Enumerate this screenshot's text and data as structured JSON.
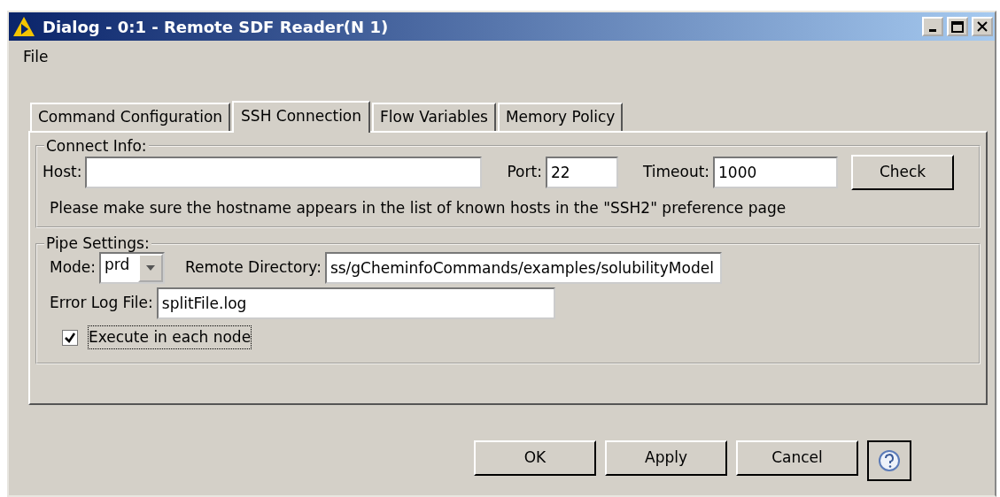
{
  "window": {
    "title": "Dialog - 0:1 - Remote SDF Reader(N 1)"
  },
  "menu": [
    "File"
  ],
  "tabs": [
    {
      "label": "Command Configuration",
      "selected": false
    },
    {
      "label": "SSH Connection",
      "selected": true
    },
    {
      "label": "Flow Variables",
      "selected": false
    },
    {
      "label": "Memory Policy",
      "selected": false
    }
  ],
  "connect_info": {
    "title": "Connect Info:",
    "host": {
      "label": "Host:"
    },
    "port": {
      "label": "Port:",
      "value": "22"
    },
    "timeout": {
      "label": "Timeout:",
      "value": "1000"
    },
    "check_button": "Check",
    "note": "Please make sure the hostname appears in the list of known hosts in the \"SSH2\" preference page"
  },
  "pipe_settings": {
    "title": "Pipe Settings:",
    "mode": {
      "label": "Mode:",
      "value": "prd"
    },
    "remote_directory": {
      "label": "Remote Directory:",
      "value": "ss/gCheminfoCommands/examples/solubilityModel"
    },
    "error_log_file": {
      "label": "Error Log File:",
      "value": "splitFile.log"
    },
    "execute_in_each_node": {
      "label": "Execute in each node",
      "checked": true
    }
  },
  "buttons": [
    "OK",
    "Apply",
    "Cancel"
  ]
}
